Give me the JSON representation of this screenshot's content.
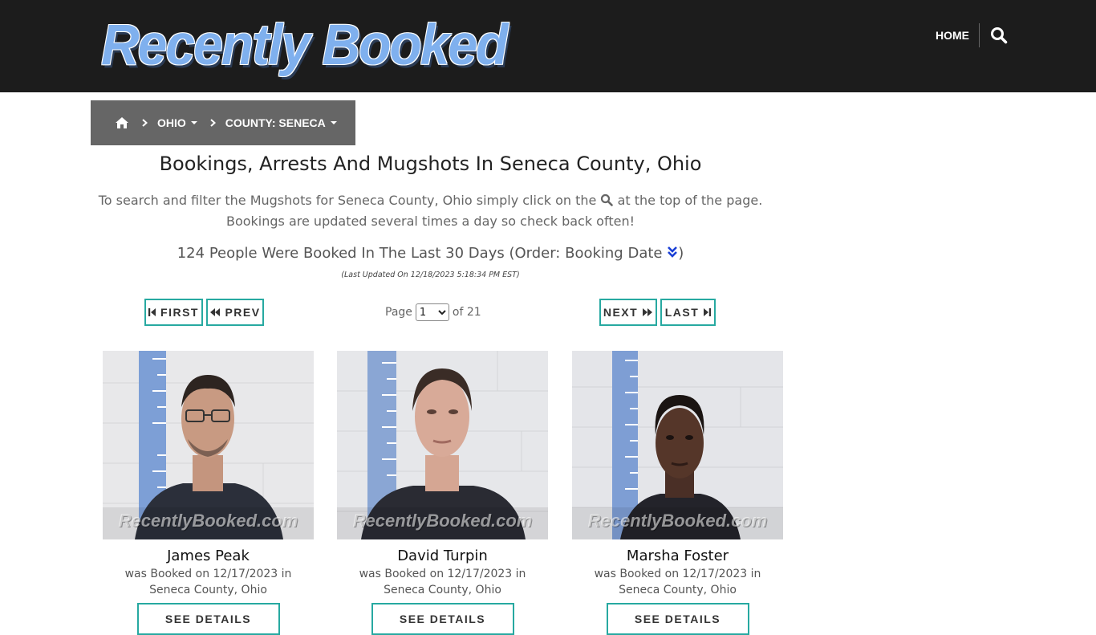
{
  "site": {
    "logo_text": "Recently Booked",
    "nav": {
      "home": "HOME",
      "search_icon": "search-icon"
    }
  },
  "breadcrumb": {
    "home_icon": "home-icon",
    "items": [
      {
        "label": "OHIO"
      },
      {
        "label": "COUNTY: SENECA"
      }
    ]
  },
  "page": {
    "title": "Bookings, Arrests And Mugshots In Seneca County, Ohio",
    "intro_before_icon": "To search and filter the Mugshots for Seneca County, Ohio simply click on the",
    "intro_after_icon": "at the top of the page. Bookings are updated several times a day so check back often!",
    "count_text": "124 People Were Booked In The Last 30 Days (Order: Booking Date",
    "count_close": ")",
    "last_updated": "(Last Updated On 12/18/2023 5:18:34 PM EST)"
  },
  "pagination": {
    "first": "FIRST",
    "prev": "PREV",
    "next": "NEXT",
    "last": "LAST",
    "page_label": "Page",
    "current_page": "1",
    "of_label": "of 21"
  },
  "watermark": "RecentlyBooked.com",
  "bookings": [
    {
      "name": "James Peak",
      "line1": "was Booked on 12/17/2023 in",
      "line2": "Seneca County, Ohio",
      "button": "SEE DETAILS"
    },
    {
      "name": "David Turpin",
      "line1": "was Booked on 12/17/2023 in",
      "line2": "Seneca County, Ohio",
      "button": "SEE DETAILS"
    },
    {
      "name": "Marsha Foster",
      "line1": "was Booked on 12/17/2023 in",
      "line2": "Seneca County, Ohio",
      "button": "SEE DETAILS"
    }
  ],
  "colors": {
    "header_bg": "#1c1c1c",
    "breadcrumb_bg": "#666666",
    "accent_teal": "#27a9a1",
    "order_icon": "#1a3fd6"
  }
}
